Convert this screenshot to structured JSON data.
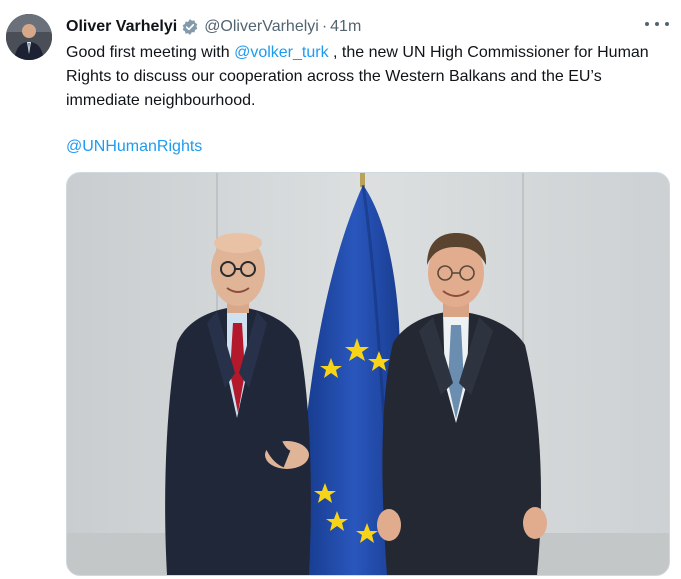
{
  "tweet": {
    "author_name": "Oliver Varhelyi",
    "author_handle": "@OliverVarhelyi",
    "separator": "·",
    "time": "41m",
    "text_part1": "Good first meeting with ",
    "mention_1": "@volker_turk",
    "text_part2": " , the new UN High Commissioner for Human Rights to discuss our cooperation across the Western Balkans and the EU’s immediate neighbourhood.",
    "mention_2": "@UNHumanRights",
    "verified_icon": "verified-badge-icon",
    "more_icon": "more-options-icon"
  },
  "colors": {
    "link": "#1d9bf0",
    "secondary_text": "#536471",
    "primary_text": "#0f1419",
    "verified": "#829aab",
    "eu_blue": "#1f4aa8",
    "eu_star": "#f7d417"
  }
}
